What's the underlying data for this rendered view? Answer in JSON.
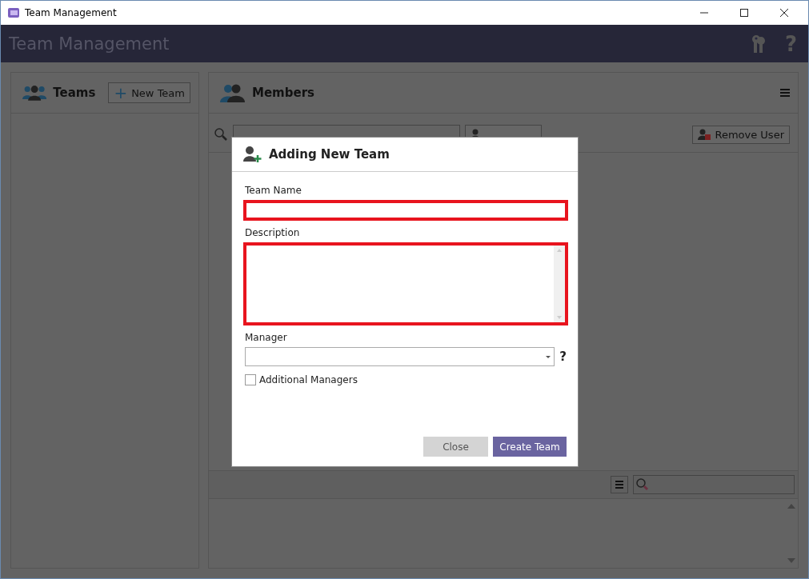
{
  "window": {
    "title": "Team Management"
  },
  "header": {
    "title": "Team Management",
    "help": "?"
  },
  "teams_panel": {
    "title": "Teams",
    "new_team_button": {
      "icon": "+",
      "label": "New Team"
    }
  },
  "members_panel": {
    "title": "Members",
    "remove_user_button": "Remove User"
  },
  "dialog": {
    "title": "Adding New Team",
    "fields": [
      {
        "label": "Team Name",
        "kind": "text",
        "highlighted": true
      },
      {
        "label": "Description",
        "kind": "textarea",
        "highlighted": true
      },
      {
        "label": "Manager",
        "kind": "select",
        "highlighted": false,
        "help": "?"
      }
    ],
    "checkbox": {
      "label": "Additional Managers",
      "checked": false
    },
    "buttons": [
      {
        "label": "Close",
        "kind": "secondary"
      },
      {
        "label": "Create Team",
        "kind": "primary"
      }
    ]
  }
}
